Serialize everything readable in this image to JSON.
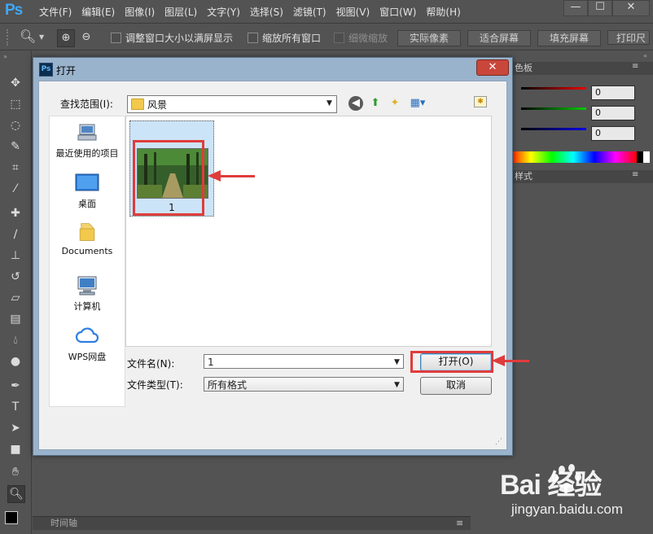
{
  "app": {
    "logo": "Ps",
    "menu": [
      "文件(F)",
      "编辑(E)",
      "图像(I)",
      "图层(L)",
      "文字(Y)",
      "选择(S)",
      "滤镜(T)",
      "视图(V)",
      "窗口(W)",
      "帮助(H)"
    ],
    "window_buttons": [
      "—",
      "☐",
      "✕"
    ]
  },
  "options_bar": {
    "fit_window_label": "调整窗口大小以满屏显示",
    "zoom_all_label": "缩放所有窗口",
    "scrubby_label": "细微缩放",
    "actual_pixels": "实际像素",
    "fit_screen": "适合屏幕",
    "fill_screen": "填充屏幕",
    "print_size": "打印尺"
  },
  "right_panel": {
    "color_panel_tab": "色板",
    "r_value": "0",
    "g_value": "0",
    "b_value": "0",
    "styles_tab": "样式"
  },
  "timeline": {
    "label": "时间轴"
  },
  "dialog": {
    "title": "打开",
    "icon_text": "Ps",
    "close": "✕",
    "look_in_label": "查找范围(I):",
    "look_in_value": "风景",
    "places": [
      {
        "label": "最近使用的项目",
        "icon": "recent-items-icon"
      },
      {
        "label": "桌面",
        "icon": "desktop-icon"
      },
      {
        "label": "Documents",
        "icon": "documents-folder-icon"
      },
      {
        "label": "计算机",
        "icon": "computer-icon"
      },
      {
        "label": "WPS网盘",
        "icon": "cloud-icon"
      }
    ],
    "files": [
      {
        "name": "1"
      }
    ],
    "file_name_label": "文件名(N):",
    "file_name_value": "1",
    "file_type_label": "文件类型(T):",
    "file_type_value": "所有格式",
    "open_button": "打开(O)",
    "cancel_button": "取消"
  },
  "watermark": {
    "brand": "Bai  经验",
    "url": "jingyan.baidu.com"
  },
  "colors": {
    "highlight_red": "#e03c3c",
    "selection_blue": "#cce4f7",
    "ps_blue": "#3fa8f5"
  }
}
